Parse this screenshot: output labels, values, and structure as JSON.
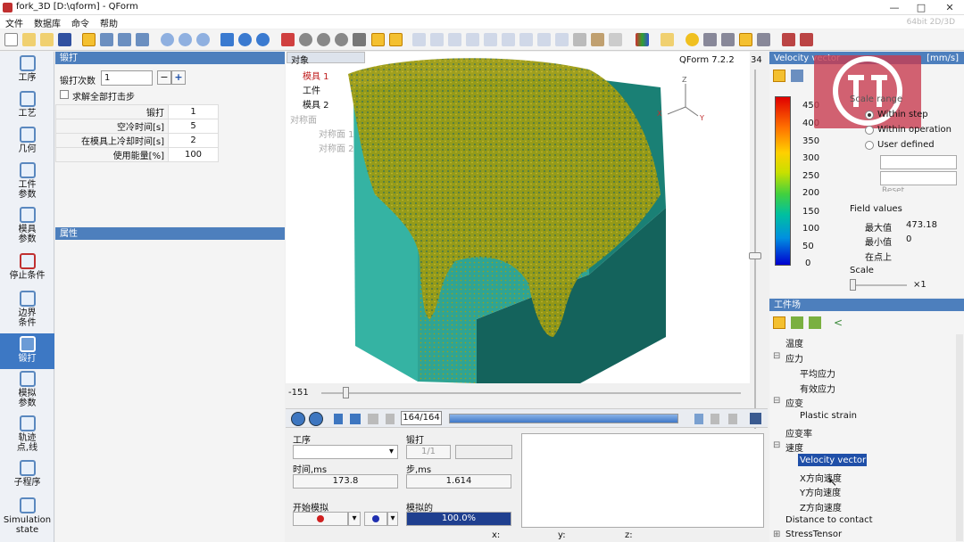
{
  "window": {
    "title": "fork_3D  [D:\\qform] - QForm",
    "min": "—",
    "max": "□",
    "close": "✕"
  },
  "menu": [
    "文件",
    "数据库",
    "命令",
    "帮助"
  ],
  "menu_right": "64bit 2D/3D",
  "nav": [
    {
      "label": "工序",
      "icon": "process-icon"
    },
    {
      "label": "工艺",
      "icon": "technology-icon"
    },
    {
      "label": "几何",
      "icon": "geometry-icon"
    },
    {
      "label": "工件\n参数",
      "icon": "workpiece-icon"
    },
    {
      "label": "模具\n参数",
      "icon": "tool-icon"
    },
    {
      "label": "停止条件",
      "icon": "stop-light-icon"
    },
    {
      "label": "边界\n条件",
      "icon": "boundary-icon"
    },
    {
      "label": "锻打",
      "icon": "blow-icon"
    },
    {
      "label": "模拟\n参数",
      "icon": "sim-params-icon"
    },
    {
      "label": "轨迹\n点,线",
      "icon": "trace-icon"
    },
    {
      "label": "子程序",
      "icon": "subroutine-icon"
    },
    {
      "label": "Simulation\nstate",
      "icon": "sim-state-icon"
    }
  ],
  "forging": {
    "header": "锻打",
    "count_label": "锻打次数",
    "count_value": "1",
    "minus": "−",
    "plus": "+",
    "checkbox_label": "求解全部打击步",
    "rows": [
      {
        "k": "锻打",
        "v": "1"
      },
      {
        "k": "空冷时间[s]",
        "v": "5"
      },
      {
        "k": "在模具上冷却时间[s]",
        "v": "2"
      },
      {
        "k": "使用能量[%]",
        "v": "100"
      }
    ]
  },
  "props_header": "属性",
  "objects": {
    "header": "对象",
    "items": [
      "模具 1",
      "工件",
      "模具 2",
      "对称面",
      "对称面 1",
      "对称面 2"
    ]
  },
  "viewport": {
    "version": "QForm 7.2.2",
    "zoom": "34",
    "slider_min": "-151",
    "axes": {
      "z": "Z",
      "x": "X",
      "y": "Y"
    }
  },
  "player": {
    "step": "164/164",
    "progress": 1.0
  },
  "sim": {
    "process_label": "工序",
    "blow_label": "锻打",
    "blow_value": "1/1",
    "time_label": "时间,ms",
    "time_value": "173.8",
    "step_label": "步,ms",
    "step_value": "1.614",
    "start_label": "开始模拟",
    "simulated_label": "模拟的",
    "simulated_value": "100.0%",
    "x": "x:",
    "y": "y:",
    "z": "z:"
  },
  "velocity": {
    "header": "Velocity vector",
    "unit": "[mm/s]",
    "legend": [
      "450",
      "400",
      "350",
      "300",
      "250",
      "200",
      "150",
      "100",
      "50",
      "0"
    ],
    "scale_range": "Scale range",
    "opt1": "Within step",
    "opt2": "Within operation",
    "opt3": "User defined",
    "reset": "Reset",
    "field_values": "Field values",
    "max_label": "最大值",
    "max_value": "473.18",
    "min_label": "最小值",
    "min_value": "0",
    "at_point": "在点上",
    "scale_label": "Scale",
    "scale_value": "×1"
  },
  "field": {
    "header": "工件场",
    "items": [
      {
        "t": "温度",
        "lvl": 0
      },
      {
        "t": "应力",
        "lvl": 0,
        "exp": "⊟"
      },
      {
        "t": "平均应力",
        "lvl": 1
      },
      {
        "t": "有效应力",
        "lvl": 1
      },
      {
        "t": "应变",
        "lvl": 0,
        "exp": "⊟"
      },
      {
        "t": "Plastic strain",
        "lvl": 1
      },
      {
        "t": "应变率",
        "lvl": 0
      },
      {
        "t": "速度",
        "lvl": 0,
        "exp": "⊟"
      },
      {
        "t": "Velocity vector",
        "lvl": 1
      },
      {
        "t": "X方向速度",
        "lvl": 1
      },
      {
        "t": "Y方向速度",
        "lvl": 1
      },
      {
        "t": "Z方向速度",
        "lvl": 1
      },
      {
        "t": "Distance to contact",
        "lvl": 0
      },
      {
        "t": "StressTensor",
        "lvl": 0,
        "exp": "⊞"
      }
    ]
  }
}
